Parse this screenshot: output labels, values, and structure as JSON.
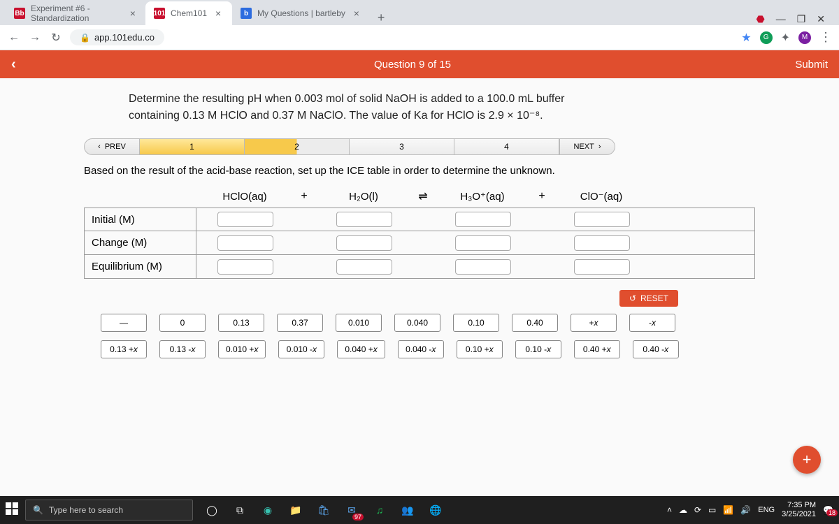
{
  "browser": {
    "tabs": [
      {
        "title": "Experiment #6 - Standardization",
        "favicon": "Bb",
        "active": false
      },
      {
        "title": "Chem101",
        "favicon": "101",
        "active": true
      },
      {
        "title": "My Questions | bartleby",
        "favicon": "b",
        "active": false
      }
    ],
    "url": "app.101edu.co",
    "win": {
      "minimize": "—",
      "restore": "❐",
      "close": "✕"
    },
    "nav": {
      "back": "←",
      "forward": "→",
      "reload": "↻"
    },
    "profile_letter": "M"
  },
  "header": {
    "back_chevron": "‹",
    "counter": "Question 9 of 15",
    "submit": "Submit"
  },
  "prompt_html": "Determine the resulting pH when 0.003 mol of solid NaOH is added to a 100.0 mL buffer containing 0.13 M HClO and 0.37 M NaClO. The value of Ka for HClO is 2.9 × 10⁻⁸.",
  "stepnav": {
    "prev": "PREV",
    "next": "NEXT",
    "steps": [
      "1",
      "2",
      "3",
      "4"
    ],
    "done_through": 1,
    "current": 2
  },
  "instruction": "Based on the result of the acid-base reaction, set up the ICE table in order to determine the unknown.",
  "equation": {
    "species": [
      "HClO(aq)",
      "H₂O(l)",
      "H₃O⁺(aq)",
      "ClO⁻(aq)"
    ],
    "ops": [
      "+",
      "⇌",
      "+"
    ]
  },
  "ice_rows": [
    "Initial (M)",
    "Change (M)",
    "Equilibrium (M)"
  ],
  "reset_label": "RESET",
  "chips": [
    "—",
    "0",
    "0.13",
    "0.37",
    "0.010",
    "0.040",
    "0.10",
    "0.40",
    "+x",
    "-x",
    "0.13 + x",
    "0.13 - x",
    "0.010 + x",
    "0.010 - x",
    "0.040 + x",
    "0.040 - x",
    "0.10 + x",
    "0.10 - x",
    "0.40 + x",
    "0.40 - x"
  ],
  "fab": "+",
  "taskbar": {
    "search_placeholder": "Type here to search",
    "lang": "ENG",
    "time": "7:35 PM",
    "date": "3/25/2021"
  }
}
